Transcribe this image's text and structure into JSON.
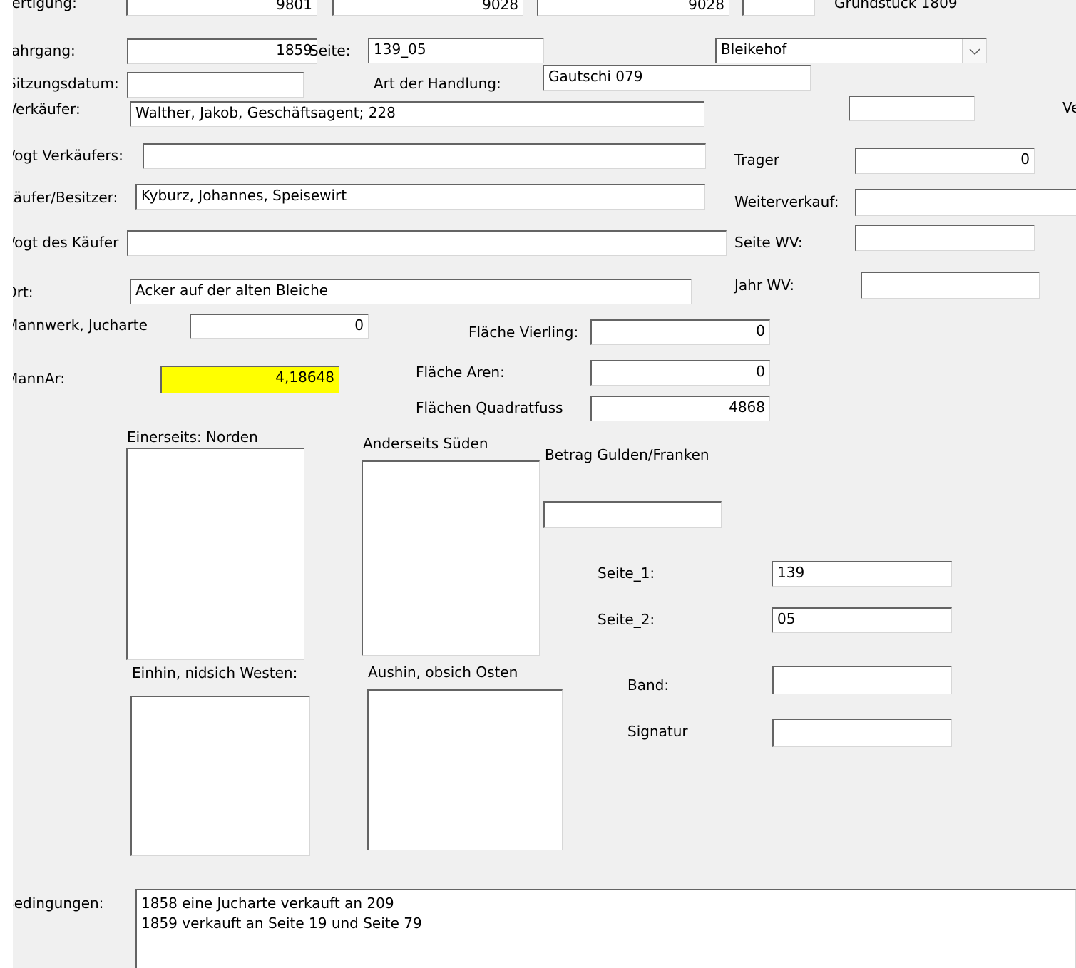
{
  "labels": {
    "fertigung": "Fertigung:",
    "jahrgang": "Jahrgang:",
    "seite": "Seite:",
    "sitzungsdatum": "Sitzungsdatum:",
    "art_der_handlung": "Art der Handlung:",
    "verkaeufer": "Verkäufer:",
    "ve_cut": "Ve",
    "vogt_verkaeufers": "Vogt Verkäufers:",
    "trager": "Trager",
    "kaeufer": "Käufer/Besitzer:",
    "weiterverkauf": "Weiterverkauf:",
    "vogt_kaeufers": "Vogt des Käufer",
    "seite_wv": "Seite WV:",
    "ort": "Ort:",
    "jahr_wv": "Jahr WV:",
    "mannwerk": "Mannwerk, Jucharte",
    "flaeche_vierling": "Fläche Vierling:",
    "mannar": "MannAr:",
    "flaeche_aren": "Fläche Aren:",
    "flaechen_quadratfuss": "Flächen Quadratfuss",
    "einerseits": "Einerseits: Norden",
    "anderseits": "Anderseits Süden",
    "betrag": "Betrag Gulden/Franken",
    "seite_1": "Seite_1:",
    "seite_2": "Seite_2:",
    "einhin": "Einhin, nidsich Westen:",
    "aushin": "Aushin,  obsich Osten",
    "band": "Band:",
    "signatur": "Signatur",
    "bedingungen": "Bedingungen:",
    "grundstueck": "Grundstück 1809"
  },
  "values": {
    "fertigung_1": "9801",
    "fertigung_2": "9028",
    "fertigung_3": "9028",
    "fertigung_4": "",
    "jahrgang": "1859",
    "seite": "139_05",
    "ort_select": "Bleikehof",
    "sitzungsdatum": "",
    "art_der_handlung": "Gautschi 079",
    "verkaeufer": "Walther, Jakob, Geschäftsagent; 228",
    "ve_field": "",
    "vogt_verkaeufers": "",
    "trager": "0",
    "kaeufer": "Kyburz, Johannes, Speisewirt",
    "weiterverkauf": "",
    "vogt_kaeufers": "",
    "seite_wv": "",
    "ort": "Acker auf der alten Bleiche",
    "jahr_wv": "",
    "mannwerk": "0",
    "flaeche_vierling": "0",
    "mannar": "4,18648",
    "flaeche_aren": "0",
    "flaechen_quadratfuss": "4868",
    "einerseits": "",
    "anderseits": "",
    "betrag": "",
    "seite_1": "139",
    "seite_2": "05",
    "einhin": "",
    "aushin": "",
    "band": "",
    "signatur": "",
    "bedingungen": "1858 eine Jucharte verkauft an 209\n1859 verkauft an Seite 19 und Seite 79"
  },
  "colors": {
    "form_background": "#f0f0f0",
    "highlight": "#ffff00"
  },
  "icons": {
    "dropdown": "chevron-down-icon"
  }
}
